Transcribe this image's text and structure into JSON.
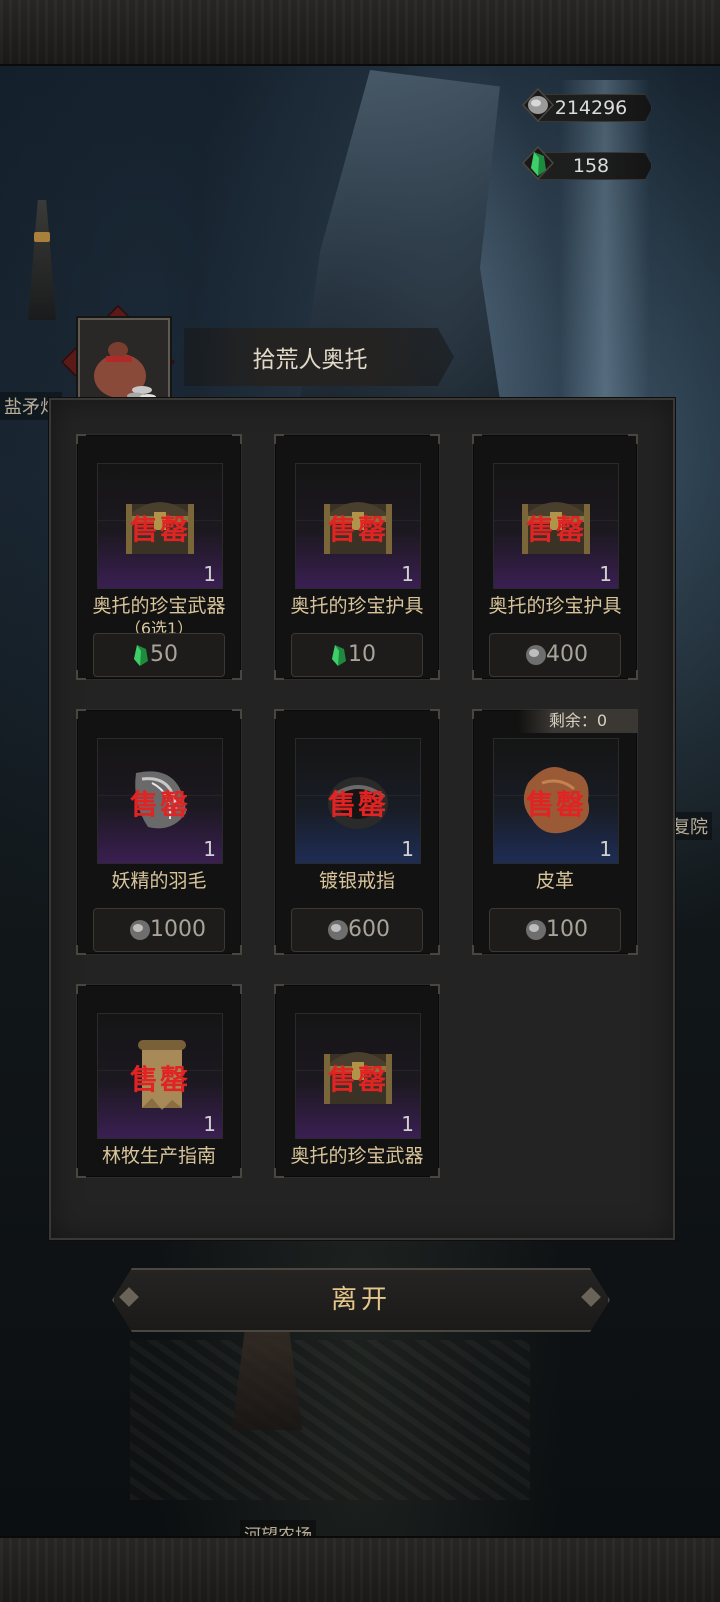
{
  "currency": {
    "silver": {
      "icon": "silver-coin-icon",
      "value": "214296"
    },
    "gem": {
      "icon": "green-gem-icon",
      "value": "158"
    }
  },
  "shop": {
    "title": "拾荒人奥托",
    "portrait_icon": "sack-of-coins-icon",
    "sold_out_label": "售罄",
    "remaining_label": "剩余：0",
    "items": [
      {
        "name": "奥托的珍宝武器",
        "subname": "（6选1）",
        "qty": "1",
        "price": "50",
        "currency": "green-gem-icon",
        "art": "treasure-chest-icon",
        "rarity": "purple"
      },
      {
        "name": "奥托的珍宝护具",
        "subname": "",
        "qty": "1",
        "price": "10",
        "currency": "green-gem-icon",
        "art": "treasure-chest-icon",
        "rarity": "purple"
      },
      {
        "name": "奥托的珍宝护具",
        "subname": "",
        "qty": "1",
        "price": "400",
        "currency": "silver-coin-icon",
        "art": "treasure-chest-icon",
        "rarity": "purple"
      },
      {
        "name": "妖精的羽毛",
        "subname": "",
        "qty": "1",
        "price": "1000",
        "currency": "silver-coin-icon",
        "art": "feather-icon",
        "rarity": "purple"
      },
      {
        "name": "镀银戒指",
        "subname": "",
        "qty": "1",
        "price": "600",
        "currency": "silver-coin-icon",
        "art": "ring-icon",
        "rarity": "blue"
      },
      {
        "name": "皮革",
        "subname": "",
        "qty": "1",
        "price": "100",
        "currency": "silver-coin-icon",
        "art": "leather-icon",
        "rarity": "blue"
      },
      {
        "name": "林牧生产指南",
        "subname": "",
        "qty": "1",
        "price": "",
        "currency": "",
        "art": "scroll-icon",
        "rarity": "purple"
      },
      {
        "name": "奥托的珍宝武器",
        "subname": "",
        "qty": "1",
        "price": "",
        "currency": "",
        "art": "treasure-chest-icon",
        "rarity": "purple"
      }
    ]
  },
  "leave_button": "离开",
  "background_labels": {
    "left": "盐矛灯",
    "right": "复院",
    "bottom": "河望农场"
  }
}
